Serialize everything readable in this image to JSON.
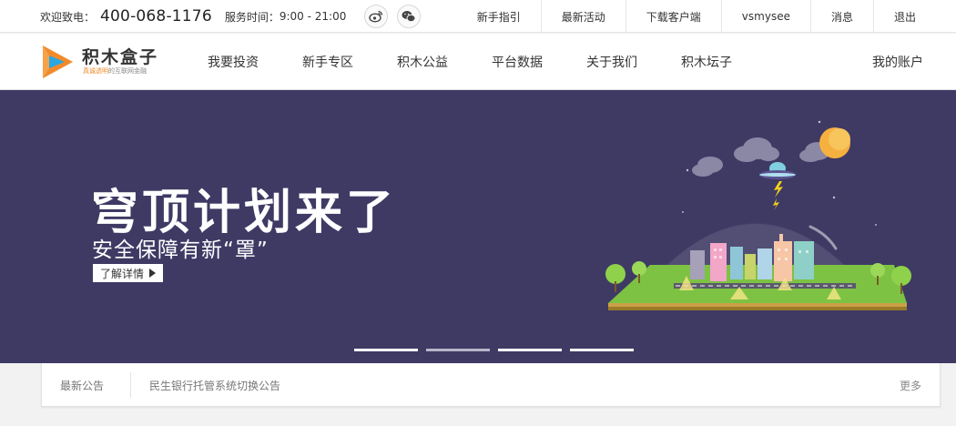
{
  "topbar": {
    "phone_label": "欢迎致电：",
    "phone": "400-068-1176",
    "hours_label": "服务时间：",
    "hours": "9:00 - 21:00",
    "social": [
      {
        "name": "weibo-icon"
      },
      {
        "name": "wechat-icon"
      }
    ],
    "links": [
      "新手指引",
      "最新活动",
      "下载客户端",
      "vsmysee",
      "消息",
      "退出"
    ]
  },
  "header": {
    "logo_name": "积木盒子",
    "logo_tag_accent": "真诚透明",
    "logo_tag_rest": "的互联网金融",
    "nav": [
      "我要投资",
      "新手专区",
      "积木公益",
      "平台数据",
      "关于我们",
      "积木坛子"
    ],
    "account": "我的账户"
  },
  "banner": {
    "title": "穹顶计划来了",
    "subtitle": "安全保障有新“罩”",
    "button": "了解详情",
    "slides": 4,
    "active_slide": 2,
    "background": "#3e3a64"
  },
  "notice": {
    "label": "最新公告",
    "text": "民生银行托管系统切换公告",
    "more": "更多"
  },
  "colors": {
    "logo_orange": "#f08b2c",
    "logo_blue": "#2aa7e0",
    "banner_bg": "#3e3a64"
  }
}
